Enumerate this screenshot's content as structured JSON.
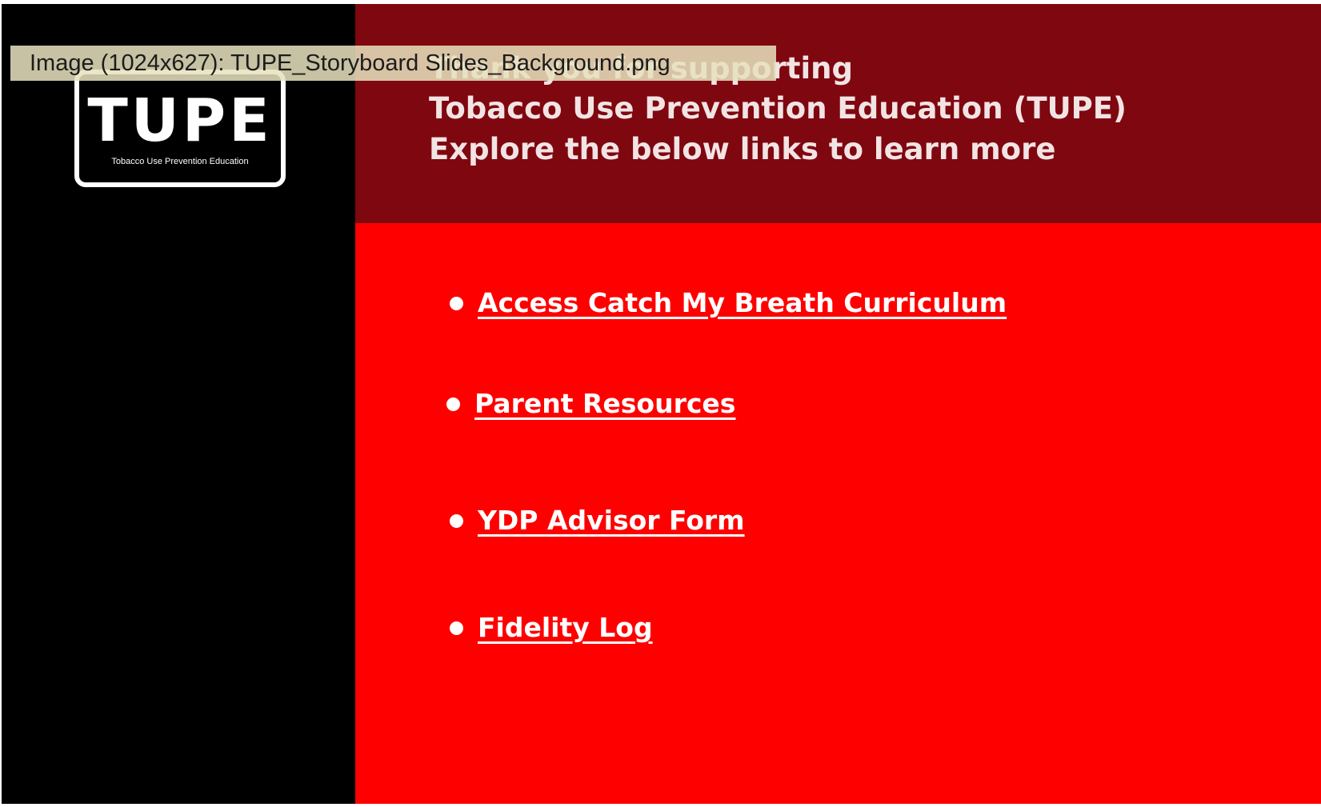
{
  "logo": {
    "wordmark": "TUPE",
    "tagline": "Tobacco Use Prevention Education"
  },
  "header": {
    "line1": "Thank you for supporting",
    "line2": "Tobacco Use Prevention Education (TUPE)",
    "line3": "Explore the below links to learn more"
  },
  "links": [
    {
      "label": "Access Catch My Breath Curriculum"
    },
    {
      "label": "Parent Resources"
    },
    {
      "label": "YDP Advisor Form"
    },
    {
      "label": "Fidelity Log"
    }
  ],
  "tooltip": {
    "text": "Image (1024x627): TUPE_Storyboard Slides_Background.png"
  },
  "colors": {
    "sidebar": "#000000",
    "header_band": "#7f0710",
    "body": "#ff0000",
    "text": "#ffffff",
    "tooltip_bg": "#e6e2be"
  }
}
